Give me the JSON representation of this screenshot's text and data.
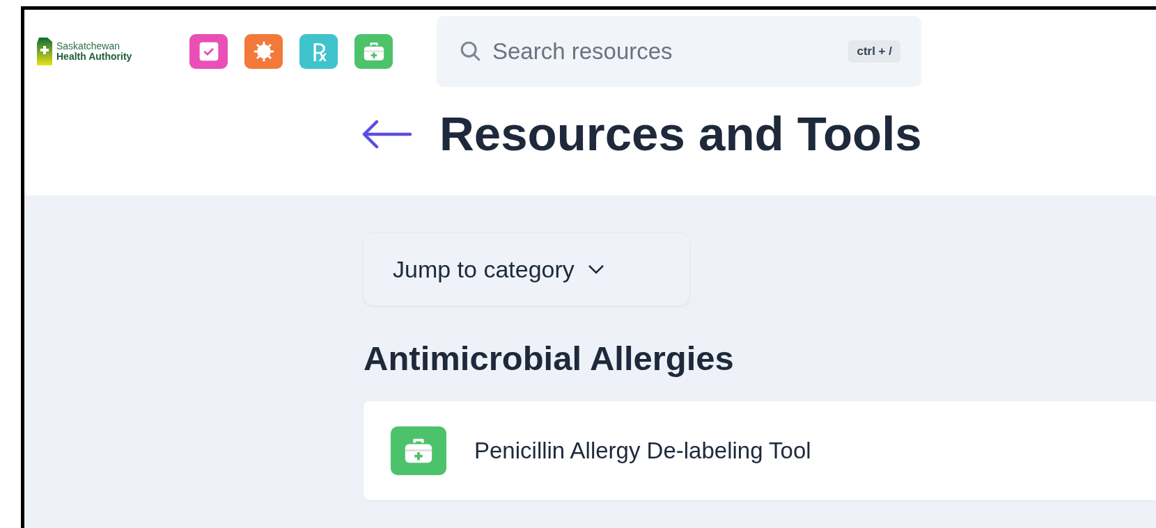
{
  "logo": {
    "line_1": "Saskatchewan",
    "line_2": "Health Authority"
  },
  "apps": [
    {
      "kind": "checklist",
      "color": "#e94fb5"
    },
    {
      "kind": "virus",
      "color": "#f2793a"
    },
    {
      "kind": "rx",
      "color": "#3fc3cc",
      "glyph": "℞"
    },
    {
      "kind": "medkit",
      "color": "#4cc36b"
    }
  ],
  "search": {
    "placeholder": "Search resources",
    "shortcut": "ctrl + /"
  },
  "title": "Resources and Tools",
  "jump": {
    "label": "Jump to category"
  },
  "sections": [
    {
      "heading": "Antimicrobial Allergies",
      "items": [
        {
          "label": "Penicillin Allergy De-labeling Tool",
          "color": "#4cc36b"
        }
      ]
    }
  ]
}
